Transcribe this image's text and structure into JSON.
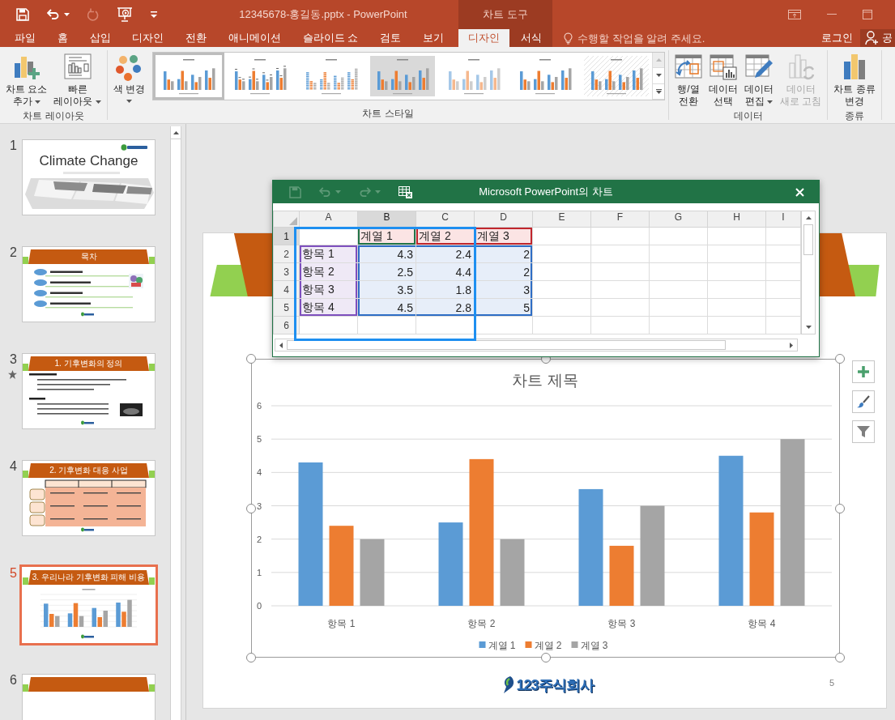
{
  "app": {
    "title": "12345678-홍길동.pptx - PowerPoint",
    "context_header": "차트 도구"
  },
  "tabs": [
    {
      "label": "파일",
      "selected": false
    },
    {
      "label": "홈",
      "selected": false
    },
    {
      "label": "삽입",
      "selected": false
    },
    {
      "label": "디자인",
      "selected": false
    },
    {
      "label": "전환",
      "selected": false
    },
    {
      "label": "애니메이션",
      "selected": false
    },
    {
      "label": "슬라이드 쇼",
      "selected": false
    },
    {
      "label": "검토",
      "selected": false
    },
    {
      "label": "보기",
      "selected": false
    }
  ],
  "context_tabs": [
    {
      "label": "디자인",
      "selected": true
    },
    {
      "label": "서식",
      "selected": false
    }
  ],
  "tell_me": {
    "placeholder": "수행할 작업을 알려 주세요."
  },
  "sign_in": "로그인",
  "share": "공",
  "ribbon_groups": [
    {
      "label": "차트 레이아웃",
      "items": [
        {
          "kind": "add-element",
          "label": "차트 요소\n추가",
          "dropdown": true,
          "disabled": false
        },
        {
          "kind": "quick-layout",
          "label": "빠른\n레이아웃",
          "dropdown": true,
          "disabled": false
        }
      ]
    },
    {
      "label": "차트 스타일",
      "items": [
        {
          "kind": "change-colors",
          "label": "색 변경",
          "dropdown": true,
          "disabled": false
        }
      ],
      "gallery": [
        {
          "kind": "plain",
          "selected": true
        },
        {
          "kind": "labeled",
          "selected": false
        },
        {
          "kind": "striped",
          "selected": false
        },
        {
          "kind": "shaded",
          "selected": false
        },
        {
          "kind": "faded",
          "selected": false
        },
        {
          "kind": "outlined",
          "selected": false
        },
        {
          "kind": "hatched",
          "selected": false
        }
      ]
    },
    {
      "label": "데이터",
      "items": [
        {
          "kind": "switch",
          "label": "행/열\n전환",
          "dropdown": false,
          "disabled": false
        },
        {
          "kind": "select-data",
          "label": "데이터\n선택",
          "dropdown": false,
          "disabled": false
        },
        {
          "kind": "edit-data",
          "label": "데이터\n편집",
          "dropdown": true,
          "disabled": false
        },
        {
          "kind": "refresh",
          "label": "데이터\n새로 고침",
          "dropdown": false,
          "disabled": true
        }
      ]
    },
    {
      "label": "종류",
      "items": [
        {
          "kind": "chart-type",
          "label": "차트 종류\n변경",
          "dropdown": false,
          "disabled": false
        }
      ]
    }
  ],
  "slides": [
    {
      "number": "1",
      "kind": "title",
      "title": "Climate Change",
      "selected": false,
      "animated": false
    },
    {
      "number": "2",
      "kind": "agenda",
      "title": "목차",
      "selected": false,
      "animated": false
    },
    {
      "number": "3",
      "kind": "bullets",
      "title": "1. 기후변화의 정의",
      "selected": false,
      "animated": true
    },
    {
      "number": "4",
      "kind": "table",
      "title": "2. 기후변화 대응 사업",
      "selected": false,
      "animated": false
    },
    {
      "number": "5",
      "kind": "chart",
      "title": "3. 우리나라 기후변화 피해 비용",
      "selected": true,
      "animated": false
    },
    {
      "number": "6",
      "kind": "blank",
      "selected": false,
      "animated": false
    }
  ],
  "data_sheet": {
    "title": "Microsoft PowerPoint의 차트",
    "columns": [
      {
        "label": "A",
        "selected": false
      },
      {
        "label": "B",
        "selected": true
      },
      {
        "label": "C",
        "selected": false
      },
      {
        "label": "D",
        "selected": false
      },
      {
        "label": "E",
        "selected": false
      },
      {
        "label": "F",
        "selected": false
      },
      {
        "label": "G",
        "selected": false
      },
      {
        "label": "H",
        "selected": false
      },
      {
        "label": "I",
        "selected": false
      }
    ],
    "rows": [
      {
        "label": "1",
        "selected": true,
        "cells": [
          {},
          {
            "text": "계열 1",
            "kind": "name-first"
          },
          {
            "text": "계열 2",
            "kind": "name"
          },
          {
            "text": "계열 3",
            "kind": "name"
          }
        ]
      },
      {
        "label": "2",
        "selected": false,
        "cells": [
          {
            "text": "항목 1",
            "kind": "category"
          },
          {
            "text": "4.3",
            "kind": "value"
          },
          {
            "text": "2.4",
            "kind": "value"
          },
          {
            "text": "2",
            "kind": "value"
          }
        ]
      },
      {
        "label": "3",
        "selected": false,
        "cells": [
          {
            "text": "항목 2",
            "kind": "category"
          },
          {
            "text": "2.5",
            "kind": "value"
          },
          {
            "text": "4.4",
            "kind": "value"
          },
          {
            "text": "2",
            "kind": "value"
          }
        ]
      },
      {
        "label": "4",
        "selected": false,
        "cells": [
          {
            "text": "항목 3",
            "kind": "category"
          },
          {
            "text": "3.5",
            "kind": "value"
          },
          {
            "text": "1.8",
            "kind": "value"
          },
          {
            "text": "3",
            "kind": "value"
          }
        ]
      },
      {
        "label": "5",
        "selected": false,
        "cells": [
          {
            "text": "항목 4",
            "kind": "category"
          },
          {
            "text": "4.5",
            "kind": "value"
          },
          {
            "text": "2.8",
            "kind": "value"
          },
          {
            "text": "5",
            "kind": "value"
          }
        ]
      },
      {
        "label": "6",
        "selected": false
      }
    ]
  },
  "slide": {
    "chart": {
      "selected": true,
      "chart_data": {
        "type": "bar",
        "title": "차트 제목",
        "categories": [
          "항목 1",
          "항목 2",
          "항목 3",
          "항목 4"
        ],
        "series": [
          {
            "name": "계열 1",
            "color": "#5b9bd5",
            "values": [
              4.3,
              2.5,
              3.5,
              4.5
            ]
          },
          {
            "name": "계열 2",
            "color": "#ed7d31",
            "values": [
              2.4,
              4.4,
              1.8,
              2.8
            ]
          },
          {
            "name": "계열 3",
            "color": "#a5a5a5",
            "values": [
              2,
              2,
              3,
              5
            ]
          }
        ],
        "ylim": [
          0,
          6
        ],
        "yticks": [
          0,
          1,
          2,
          3,
          4,
          5,
          6
        ],
        "grid": true,
        "legend": true
      }
    },
    "logo": "123주식회사",
    "page_number": "5"
  }
}
